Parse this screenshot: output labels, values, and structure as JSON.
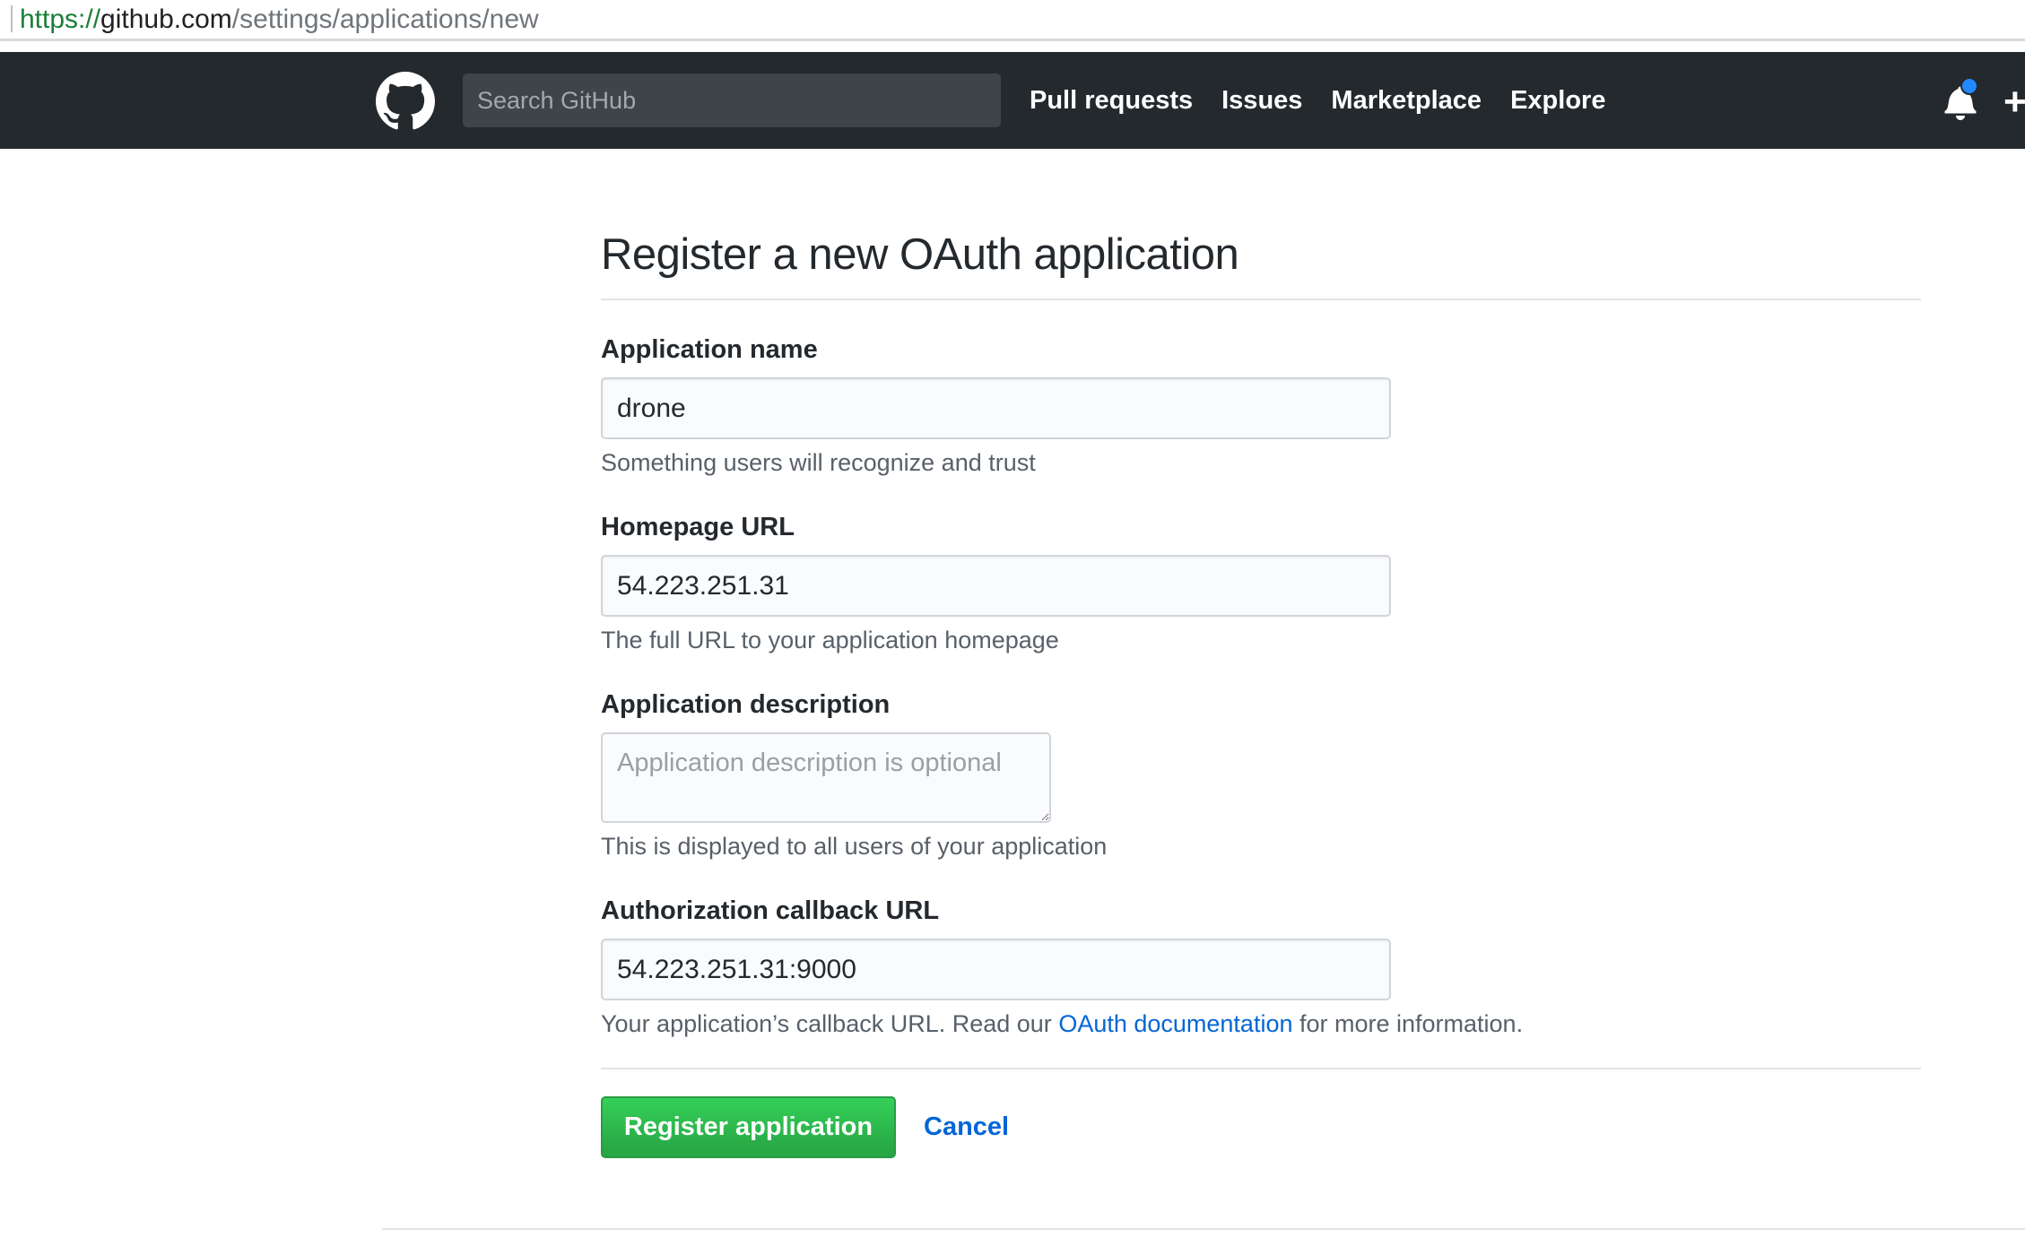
{
  "browser": {
    "url_scheme": "https://",
    "url_host": "github.com",
    "url_path": "/settings/applications/new"
  },
  "header": {
    "search_placeholder": "Search GitHub",
    "nav": [
      "Pull requests",
      "Issues",
      "Marketplace",
      "Explore"
    ],
    "notification_dot_color": "#2188ff",
    "plus_label": "+"
  },
  "form": {
    "title": "Register a new OAuth application",
    "app_name": {
      "label": "Application name",
      "value": "drone",
      "note": "Something users will recognize and trust"
    },
    "homepage": {
      "label": "Homepage URL",
      "value": "54.223.251.31",
      "note": "The full URL to your application homepage"
    },
    "description": {
      "label": "Application description",
      "placeholder": "Application description is optional",
      "note": "This is displayed to all users of your application"
    },
    "callback": {
      "label": "Authorization callback URL",
      "value": "54.223.251.31:9000",
      "note_before": "Your application’s callback URL. Read our ",
      "note_link": "OAuth documentation",
      "note_after": " for more information."
    },
    "submit_label": "Register application",
    "cancel_label": "Cancel"
  },
  "colors": {
    "header_bg": "#24292e",
    "primary_button": "#28a745",
    "link": "#0366d6"
  }
}
